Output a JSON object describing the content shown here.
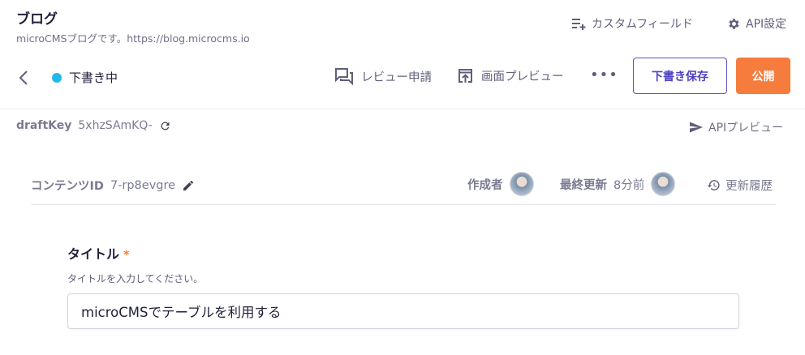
{
  "header": {
    "title": "ブログ",
    "description": "microCMSブログです。https://blog.microcms.io",
    "custom_fields_label": "カスタムフィールド",
    "api_settings_label": "API設定"
  },
  "toolbar": {
    "status_label": "下書き中",
    "status_color": "#22b8ea",
    "review_label": "レビュー申請",
    "screen_preview_label": "画面プレビュー",
    "more_label": "•••",
    "save_draft_label": "下書き保存",
    "publish_label": "公開"
  },
  "draft": {
    "key_label": "draftKey",
    "key_value": "5xhzSAmKQ-",
    "api_preview_label": "APIプレビュー"
  },
  "meta": {
    "content_id_label": "コンテンツID",
    "content_id_value": "7-rp8evgre",
    "author_label": "作成者",
    "updated_label": "最終更新",
    "updated_value": "8分前",
    "history_label": "更新履歴"
  },
  "field": {
    "label": "タイトル",
    "required_mark": "*",
    "description": "タイトルを入力してください。",
    "value": "microCMSでテーブルを利用する"
  },
  "colors": {
    "accent": "#4b41c1",
    "publish": "#f57c3d"
  }
}
